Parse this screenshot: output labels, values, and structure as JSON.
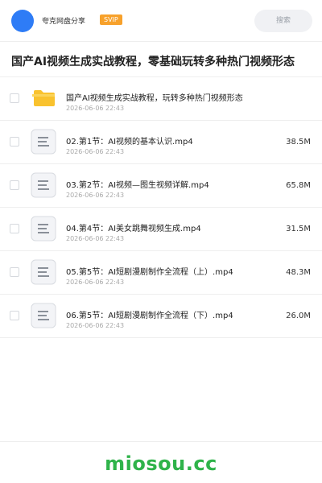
{
  "header": {
    "user_name": "夸克网盘分享",
    "badge": "SVIP",
    "search_placeholder": "搜索"
  },
  "page_title": "国产AI视频生成实战教程，零基础玩转多种热门视频形态",
  "items": [
    {
      "type": "folder",
      "name": "国产AI视频生成实战教程，玩转多种热门视频形态",
      "date": "2026-06-06 22:43",
      "size": ""
    },
    {
      "type": "file",
      "name": "02.第1节：AI视频的基本认识.mp4",
      "date": "2026-06-06 22:43",
      "size": "38.5M"
    },
    {
      "type": "file",
      "name": "03.第2节：AI视频—图生视频详解.mp4",
      "date": "2026-06-06 22:43",
      "size": "65.8M"
    },
    {
      "type": "file",
      "name": "04.第4节：AI美女跳舞视频生成.mp4",
      "date": "2026-06-06 22:43",
      "size": "31.5M"
    },
    {
      "type": "file",
      "name": "05.第5节：AI短剧漫剧制作全流程（上）.mp4",
      "date": "2026-06-06 22:43",
      "size": "48.3M"
    },
    {
      "type": "file",
      "name": "06.第5节：AI短剧漫剧制作全流程（下）.mp4",
      "date": "2026-06-06 22:43",
      "size": "26.0M"
    }
  ],
  "watermark": "miosou.cc",
  "colors": {
    "avatar": "#2e7cf6",
    "badge": "#f7a12b",
    "folder": "#f9c22e",
    "watermark": "#2fb34a"
  },
  "icons": {
    "folder": "folder-icon",
    "file": "document-icon"
  }
}
